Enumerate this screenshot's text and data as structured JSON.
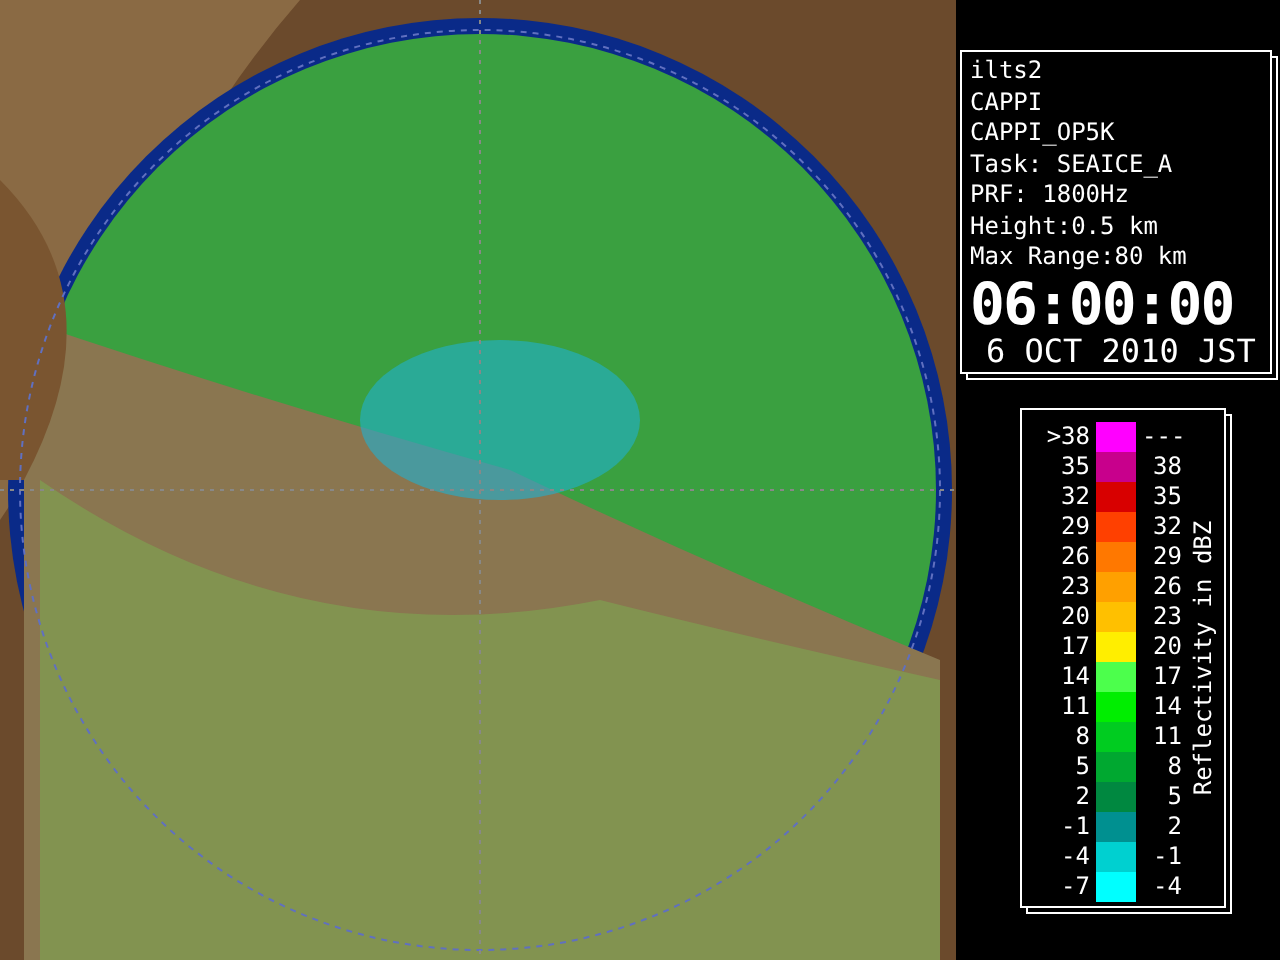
{
  "info": {
    "lines": [
      "ilts2",
      "CAPPI",
      "CAPPI_OP5K",
      "Task: SEAICE_A",
      "PRF: 1800Hz",
      "Height:0.5 km",
      "Max Range:80 km"
    ],
    "time": "06:00:00",
    "date": "6 OCT 2010 JST"
  },
  "legend": {
    "title": "Reflectivity in dBZ",
    "rows": [
      {
        "low": ">38",
        "high": "---",
        "color": "#ff00ff"
      },
      {
        "low": "35",
        "high": "38",
        "color": "#c8008c"
      },
      {
        "low": "32",
        "high": "35",
        "color": "#d80000"
      },
      {
        "low": "29",
        "high": "32",
        "color": "#ff4000"
      },
      {
        "low": "26",
        "high": "29",
        "color": "#ff7800"
      },
      {
        "low": "23",
        "high": "26",
        "color": "#ffa000"
      },
      {
        "low": "20",
        "high": "23",
        "color": "#ffc000"
      },
      {
        "low": "17",
        "high": "20",
        "color": "#ffee00"
      },
      {
        "low": "14",
        "high": "17",
        "color": "#4cff4c"
      },
      {
        "low": "11",
        "high": "14",
        "color": "#00ee00"
      },
      {
        "low": "8",
        "high": "11",
        "color": "#00cc20"
      },
      {
        "low": "5",
        "high": "8",
        "color": "#00a830"
      },
      {
        "low": "2",
        "high": "5",
        "color": "#008840"
      },
      {
        "low": "-1",
        "high": "2",
        "color": "#009090"
      },
      {
        "low": "-4",
        "high": "-1",
        "color": "#00d0d0"
      },
      {
        "low": "-7",
        "high": "-4",
        "color": "#00ffff"
      }
    ]
  }
}
